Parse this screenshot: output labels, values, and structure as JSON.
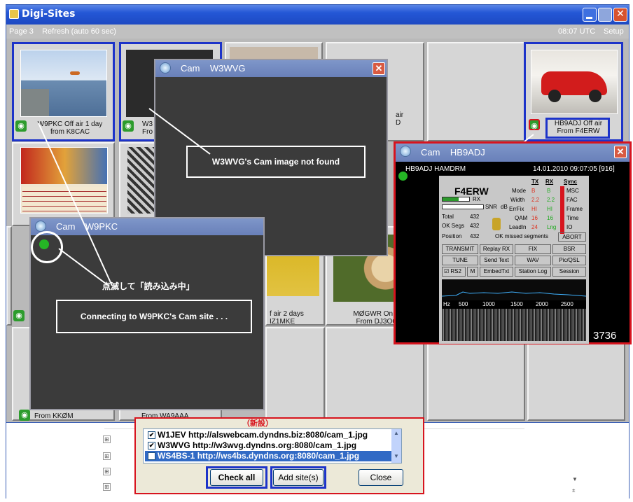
{
  "window": {
    "title": "Digi-Sites"
  },
  "menubar": {
    "left": "Page 3    Refresh (auto 60 sec)",
    "time": "08:07 UTC",
    "setup": "Setup"
  },
  "thumbs": {
    "w9pkc_caption_1": "W9PKC Off air 1 day",
    "w9pkc_caption_2": "from  K8CAC",
    "w3_caption_1": "W3",
    "w3_caption_2": "Fro",
    "air_caption": "air",
    "air_caption_2": "D",
    "hb9adj_caption_1": "HB9ADJ Off air",
    "hb9adj_caption_2": "From  F4ERW",
    "offair2_caption_1": "f air 2 days",
    "offair2_caption_2": "IZ1MKE",
    "m0gwr_caption_1": "MØGWR On ai",
    "m0gwr_caption_2": "From  DJ3OC",
    "kk0m_caption": "From  KKØM",
    "wa9aaa_caption": "From  WA9AAA"
  },
  "cam_w3wvg": {
    "title": "Cam    W3WVG",
    "message": "W3WVG's Cam image not found"
  },
  "cam_w9pkc": {
    "title": "Cam    W9PKC",
    "message": "Connecting to W9PKC's Cam site . . ."
  },
  "annotation": {
    "blink_text": "点滅して「読み込み中」"
  },
  "cam_hb9adj": {
    "title": "Cam    HB9ADJ",
    "station": "HB9ADJ HAMDRM",
    "datetime": "14.01.2010 09:07:05  [916]",
    "callsign": "F4ERW",
    "rx": "RX",
    "snr": "SNR",
    "db": "dB",
    "total_label": "Total",
    "total_val": "432",
    "oksegs_label": "OK Segs",
    "oksegs_val": "432",
    "position_label": "Position",
    "position_val": "432",
    "missed": "OK  missed segments",
    "mode": "Mode",
    "width": "Width",
    "errfix": "ErrFix",
    "qam": "QAM",
    "leadin": "LeadIn",
    "tx_head": "TX",
    "rx_head": "RX",
    "sync_head": "Sync",
    "tx_vals": [
      "B",
      "2.2",
      "HI",
      "16",
      "24"
    ],
    "rx_vals": [
      "B",
      "2.2",
      "HI",
      "16",
      "Lng"
    ],
    "sync_labels": [
      "MSC",
      "FAC",
      "Frame",
      "Time",
      "IO"
    ],
    "abort": "ABORT",
    "buttons": [
      "TRANSMIT",
      "Replay RX",
      "FIX",
      "BSR",
      "TUNE",
      "Send Text",
      "WAV",
      "Pic/QSL",
      "RS2",
      "M",
      "EmbedTxt",
      "Station Log",
      "Session"
    ],
    "hz": "Hz",
    "freqs": [
      "500",
      "1000",
      "1500",
      "2000",
      "2500"
    ],
    "counter": "3736"
  },
  "dialog": {
    "new_label": "（新設）",
    "sites": [
      {
        "call": "W1JEV",
        "url": "http://alswebcam.dyndns.biz:8080/cam_1.jpg",
        "checked": "✔"
      },
      {
        "call": "W3WVG",
        "url": "http://w3wvg.dyndns.org:8080/cam_1.jpg",
        "checked": "✔"
      },
      {
        "call": "WS4BS-1",
        "url": "http://ws4bs.dyndns.org:8080/cam_1.jpg",
        "checked": "✔"
      }
    ],
    "check_all": "Check all",
    "add_sites": "Add site(s)",
    "close": "Close"
  },
  "colors": {
    "title_blue": "#2457d6",
    "highlight_blue": "#1c33c9",
    "red_frame": "#d7141e",
    "panel_gray": "#b9b9b9"
  }
}
